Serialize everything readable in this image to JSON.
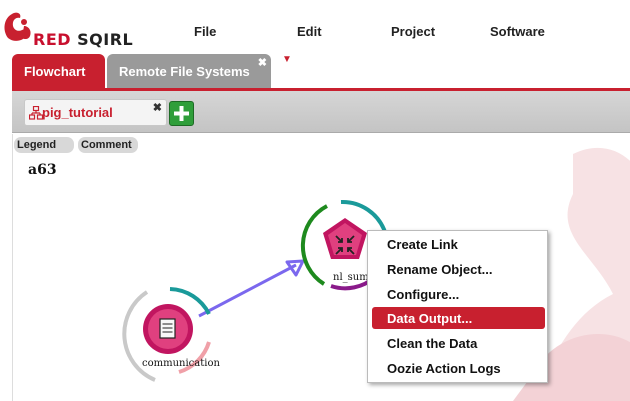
{
  "app": {
    "logo_text_red": "RED",
    "logo_text_black": "SQIRL"
  },
  "menu": [
    "File",
    "Edit",
    "Project",
    "Software"
  ],
  "tabs": [
    {
      "label": "Flowchart",
      "active": true
    },
    {
      "label": "Remote File Systems",
      "active": false
    }
  ],
  "subtabs": {
    "pig_tab_label": "pig_tutorial",
    "close_glyph": "✖"
  },
  "canvas": {
    "legend_label": "Legend",
    "comment_label": "Comment",
    "title": "a63",
    "nodes": [
      {
        "label": "communication",
        "icon": "document-icon"
      },
      {
        "label": "nl_sum",
        "icon": "compress-arrows-icon"
      }
    ]
  },
  "context_menu": {
    "items": [
      {
        "label": "Create Link",
        "active": false
      },
      {
        "label": "Rename Object...",
        "active": false
      },
      {
        "label": "Configure...",
        "active": false
      },
      {
        "label": "Data Output...",
        "active": true
      },
      {
        "label": "Clean the Data",
        "active": false
      },
      {
        "label": "Oozie Action Logs",
        "active": false
      }
    ]
  },
  "colors": {
    "brand_red": "#c8202f",
    "node_pink": "#d81b6a",
    "link_purple": "#7b68ee",
    "arc_teal": "#1a9a9a",
    "arc_green": "#1e8a1e"
  }
}
